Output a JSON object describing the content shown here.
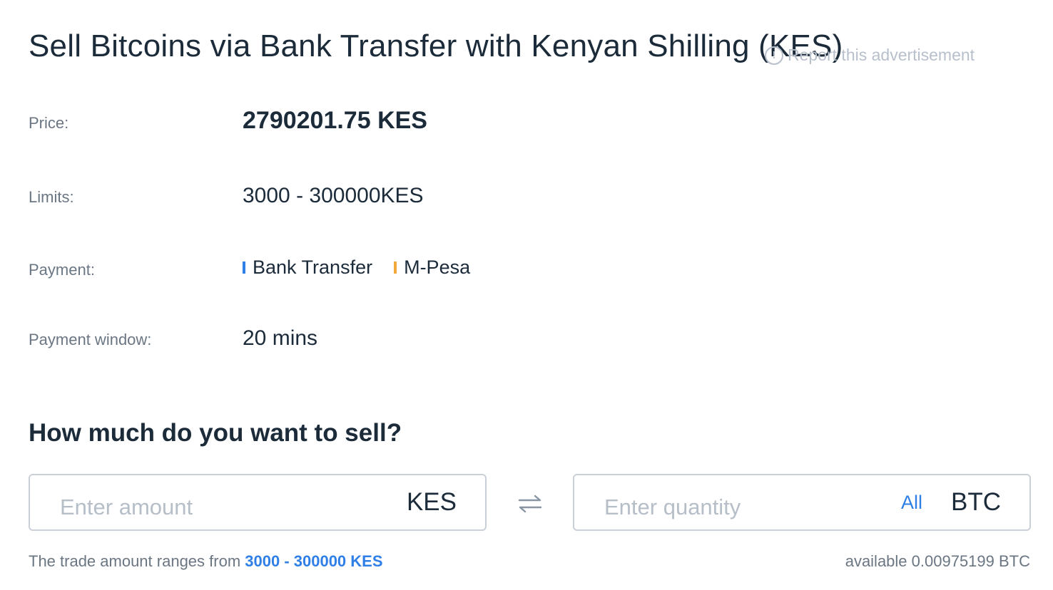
{
  "header": {
    "title": "Sell Bitcoins via Bank Transfer with Kenyan Shilling (KES)",
    "report_label": "Report this advertisement",
    "report_icon": "info-icon"
  },
  "details": {
    "price_label": "Price:",
    "price_value": "2790201.75 KES",
    "limits_label": "Limits:",
    "limits_value": "3000 - 300000KES",
    "payment_label": "Payment:",
    "payment_methods": [
      {
        "name": "Bank Transfer",
        "color": "#2f7fe6"
      },
      {
        "name": "M-Pesa",
        "color": "#f2a93b"
      }
    ],
    "window_label": "Payment window:",
    "window_value": "20 mins"
  },
  "sell": {
    "heading": "How much do you want to sell?",
    "amount_placeholder": "Enter amount",
    "amount_currency": "KES",
    "swap_icon": "swap-arrows-icon",
    "quantity_placeholder": "Enter quantity",
    "all_label": "All",
    "quantity_currency": "BTC",
    "hint_prefix": "The trade amount ranges from ",
    "hint_range": "3000 - 300000 KES",
    "available": "available 0.00975199 BTC"
  },
  "colors": {
    "accent": "#2f7fe6",
    "text": "#1c2b3a",
    "muted": "#6b7683"
  }
}
